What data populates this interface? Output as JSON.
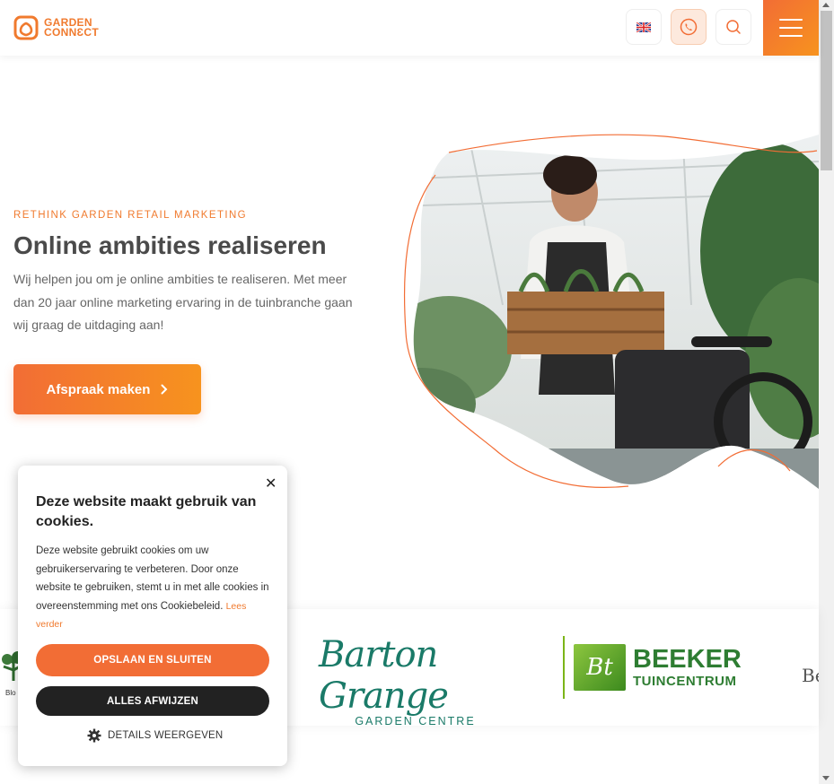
{
  "header": {
    "logo_line1": "GARDEN",
    "logo_line2": "CONNƐCT",
    "language_flag": "uk-flag-icon",
    "phone_icon": "phone-icon",
    "search_icon": "search-icon",
    "menu_icon": "hamburger-icon"
  },
  "colors": {
    "accent": "#f26d35",
    "accent_light": "#f7931e",
    "dark": "#222222"
  },
  "hero": {
    "eyebrow": "RETHINK GARDEN RETAIL MARKETING",
    "title": "Online ambities realiseren",
    "text": "Wij helpen jou om je online ambities te realiseren. Met meer dan 20 jaar online marketing ervaring in de tuinbranche gaan wij graag de uitdaging aan!",
    "cta_label": "Afspraak maken",
    "cta_icon": "chevron-right-icon"
  },
  "logos": {
    "barton_script": "Barton Grange",
    "barton_sub": "GARDEN CENTRE",
    "beeker_mark": "Bt",
    "beeker_line1": "BEEKER",
    "beeker_line2": "TUINCENTRUM",
    "left_partial": "Blo",
    "right_partial": "Be"
  },
  "cookie": {
    "close": "✕",
    "title": "Deze website maakt gebruik van cookies.",
    "text": "Deze website gebruikt cookies om uw gebruikerservaring te verbeteren. Door onze website te gebruiken, stemt u in met alle cookies in overeenstemming met ons Cookiebeleid.",
    "link": "Lees verder",
    "accept": "OPSLAAN EN SLUITEN",
    "reject": "ALLES AFWIJZEN",
    "details": "DETAILS WEERGEVEN",
    "details_icon": "gear-icon"
  }
}
